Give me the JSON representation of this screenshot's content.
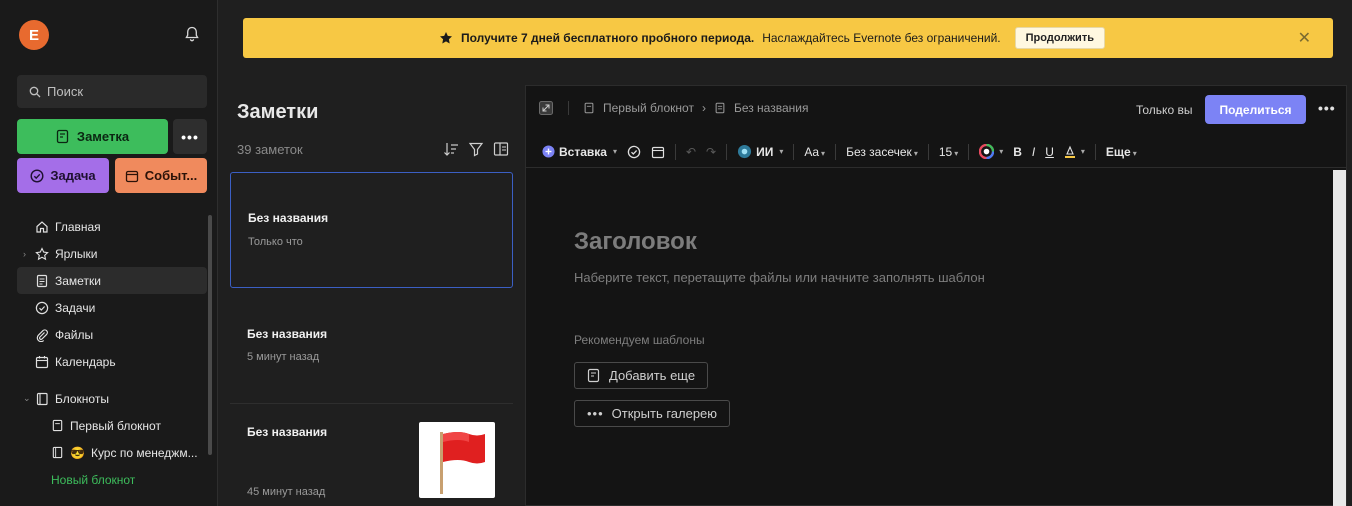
{
  "sidebar": {
    "avatar_letter": "E",
    "search_placeholder": "Поиск",
    "new_note_label": "Заметка",
    "new_task_label": "Задача",
    "new_event_label": "Событ...",
    "more_label": "•••",
    "items": [
      {
        "label": "Главная",
        "icon": "home-icon"
      },
      {
        "label": "Ярлыки",
        "icon": "star-icon"
      },
      {
        "label": "Заметки",
        "icon": "note-icon"
      },
      {
        "label": "Задачи",
        "icon": "check-circle-icon"
      },
      {
        "label": "Файлы",
        "icon": "paperclip-icon"
      },
      {
        "label": "Календарь",
        "icon": "calendar-icon"
      },
      {
        "label": "Блокноты",
        "icon": "notebook-icon"
      },
      {
        "label": "Первый блокнот",
        "icon": "notebook-icon"
      },
      {
        "label": "Курс по менеджм...",
        "icon": "notebook-icon",
        "emoji": "😎"
      },
      {
        "label": "Новый блокнот",
        "icon": "plus-icon"
      }
    ]
  },
  "banner": {
    "bold_text": "Получите 7 дней бесплатного пробного периода.",
    "text": "Наслаждайтесь Evernote без ограничений.",
    "cta": "Продолжить",
    "close": "✕",
    "color": "#f7c844"
  },
  "notes": {
    "title": "Заметки",
    "count": "39 заметок",
    "cards": [
      {
        "title": "Без названия",
        "time": "Только что"
      },
      {
        "title": "Без названия",
        "time": "5 минут назад"
      },
      {
        "title": "Без названия",
        "time": "45 минут назад"
      }
    ]
  },
  "editor": {
    "breadcrumb_notebook": "Первый блокнот",
    "breadcrumb_sep": "›",
    "breadcrumb_note": "Без названия",
    "only_you": "Только вы",
    "share": "Поделиться",
    "more": "•••",
    "toolbar": {
      "insert": "Вставка",
      "ai": "ИИ",
      "font_size_icon": "Aa",
      "font": "Без засечек",
      "size": "15",
      "bold": "B",
      "italic": "I",
      "underline": "U",
      "more": "Еще"
    },
    "heading_placeholder": "Заголовок",
    "body_placeholder": "Наберите текст, перетащите файлы или начните заполнять шаблон",
    "recommend_label": "Рекомендуем шаблоны",
    "add_more": "Добавить еще",
    "open_gallery": "Открыть галерею"
  },
  "colors": {
    "accent_green": "#3dbd5c",
    "accent_purple": "#a46ee8",
    "accent_orange": "#f08a5d",
    "share_blue": "#7c83f5"
  }
}
